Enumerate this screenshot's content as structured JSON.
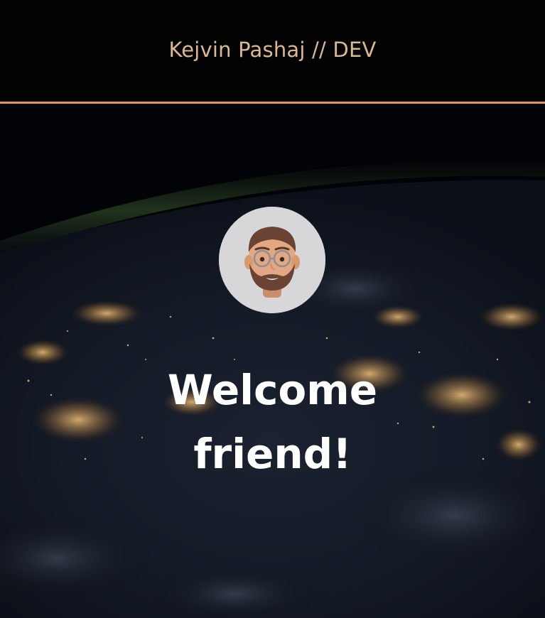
{
  "header": {
    "brand": "Kejvin Pashaj // DEV",
    "accent_color": "#e8915a",
    "brand_color": "#d9b893"
  },
  "hero": {
    "background": "earth-at-night-from-space",
    "avatar": "memoji-avatar",
    "welcome_line1": "Welcome",
    "welcome_line2": "friend!"
  }
}
